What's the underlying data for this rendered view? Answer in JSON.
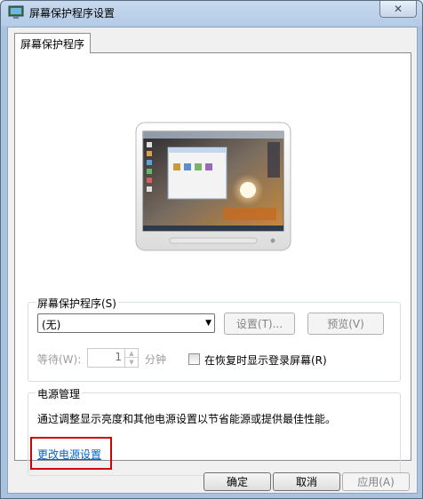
{
  "window": {
    "title": "屏幕保护程序设置",
    "close_glyph": "✕"
  },
  "tabs": [
    {
      "label": "屏幕保护程序"
    }
  ],
  "screensaver": {
    "group_label": "屏幕保护程序(S)",
    "selected": "(无)",
    "settings_button": "设置(T)...",
    "preview_button": "预览(V)",
    "wait_label": "等待(W):",
    "wait_value": "1",
    "wait_unit": "分钟",
    "resume_checkbox_label": "在恢复时显示登录屏幕(R)",
    "resume_checked": false
  },
  "power": {
    "group_label": "电源管理",
    "description": "通过调整显示亮度和其他电源设置以节省能源或提供最佳性能。",
    "link": "更改电源设置"
  },
  "footer": {
    "ok": "确定",
    "cancel": "取消",
    "apply": "应用(A)"
  },
  "colors": {
    "link": "#0066cc",
    "highlight": "#d40000",
    "titlebar": "#b4cbe6"
  }
}
